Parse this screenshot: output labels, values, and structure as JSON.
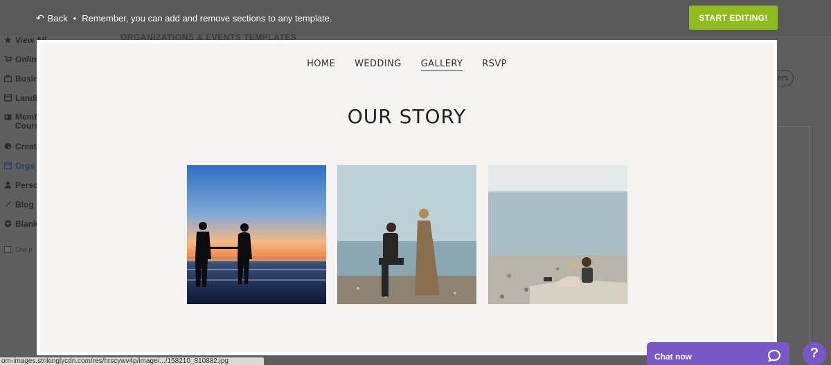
{
  "topbar": {
    "back_label": "Back",
    "separator": "•",
    "notice": "Remember, you can add and remove sections to any template.",
    "start_editing": "START EDITING!"
  },
  "background": {
    "heading": "ORGANIZATIONS & EVENTS TEMPLATES",
    "filter_pill": "ers",
    "sidebar": [
      {
        "label": "View All",
        "icon": "star-icon"
      },
      {
        "label": "Onlin",
        "icon": "cart-icon"
      },
      {
        "label": "Busin",
        "icon": "briefcase-icon"
      },
      {
        "label": "Landi",
        "icon": "browser-icon"
      },
      {
        "label": "Memb\nCours",
        "icon": "id-card-icon"
      },
      {
        "label": "Creat",
        "icon": "palette-icon"
      },
      {
        "label": "Orgs",
        "icon": "calendar-icon"
      },
      {
        "label": "Perso",
        "icon": "person-icon"
      },
      {
        "label": "Blog",
        "icon": "pen-icon"
      },
      {
        "label": "Blank",
        "icon": "plus-circle-icon"
      }
    ],
    "checkbox_label": "One p"
  },
  "preview": {
    "nav": [
      {
        "label": "HOME"
      },
      {
        "label": "WEDDING"
      },
      {
        "label": "GALLERY",
        "current": true
      },
      {
        "label": "RSVP"
      }
    ],
    "title": "OUR STORY",
    "photos": [
      {
        "name": "sunset-couple-photo"
      },
      {
        "name": "beach-proposal-photo"
      },
      {
        "name": "couple-on-shore-photo"
      }
    ]
  },
  "statusbar": {
    "url": "om-images.strikinglycdn.com/res/hrscywv4p/image/.../158210_810882.jpg"
  },
  "chat": {
    "label": "Chat now",
    "icon": "chat-bubble-icon"
  },
  "help": {
    "label": "?"
  },
  "colors": {
    "accent_green": "#8fbb1f",
    "chat_purple": "#7a57c6",
    "overlay": "#5e5e5e"
  }
}
